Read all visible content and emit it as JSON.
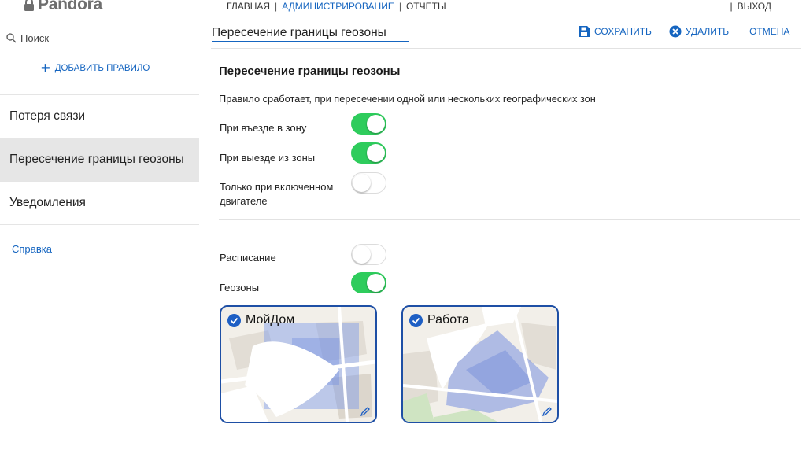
{
  "app": {
    "logo_text": "Pandora"
  },
  "topnav": {
    "items": [
      "ГЛАВНАЯ",
      "АДМИНИСТРИРОВАНИЕ",
      "ОТЧЕТЫ"
    ],
    "active_index": 1,
    "exit": "ВЫХОД"
  },
  "sidebar": {
    "search_placeholder": "Поиск",
    "add_rule": "ДОБАВИТЬ ПРАВИЛО",
    "rules": [
      {
        "label": "Потеря связи",
        "selected": false
      },
      {
        "label": "Пересечение границы геозоны",
        "selected": true
      },
      {
        "label": "Уведомления",
        "selected": false
      }
    ],
    "help": "Справка"
  },
  "header": {
    "rule_name": "Пересечение границы геозоны",
    "save": "СОХРАНИТЬ",
    "delete": "УДАЛИТЬ",
    "cancel": "ОТМЕНА"
  },
  "form": {
    "section_title": "Пересечение границы геозоны",
    "description": "Правило сработает, при пересечении одной или нескольких географических зон",
    "enter_zone": {
      "label": "При въезде в зону",
      "on": true
    },
    "exit_zone": {
      "label": "При выезде из зоны",
      "on": true
    },
    "engine_on": {
      "label": "Только при включенном двигателе",
      "on": false
    },
    "schedule": {
      "label": "Расписание",
      "on": false
    },
    "geozones": {
      "label": "Геозоны",
      "on": true
    }
  },
  "geozone_cards": [
    {
      "name": "МойДом",
      "selected": true
    },
    {
      "name": "Работа",
      "selected": true
    }
  ],
  "colors": {
    "accent": "#1565c0",
    "toggle_on": "#2ecc5c",
    "card_border": "#1e4fa5",
    "selected_row": "#e6e6e6"
  },
  "icons": [
    "lock-icon",
    "search-icon",
    "plus-icon",
    "save-icon",
    "delete-icon",
    "check-icon",
    "edit-icon"
  ]
}
